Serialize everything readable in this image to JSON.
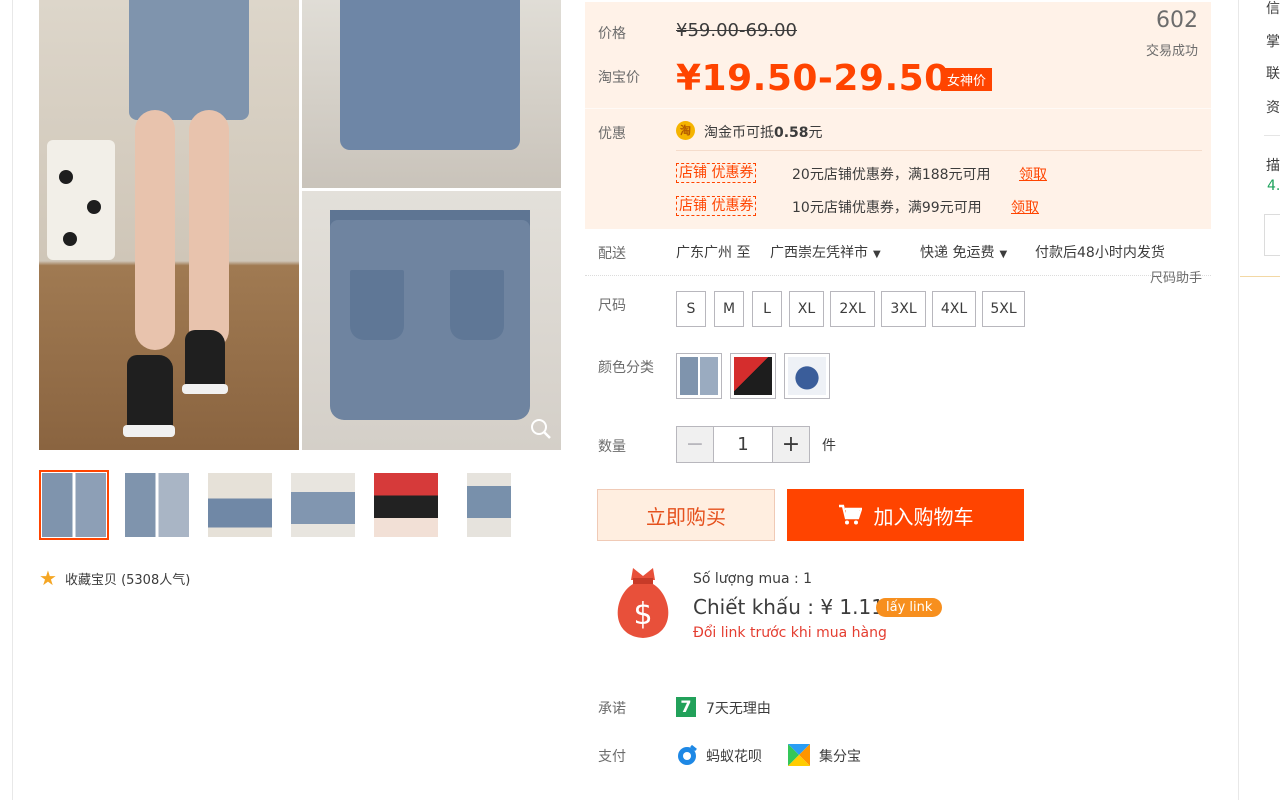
{
  "gallery": {
    "favorite_label": "收藏宝贝 (5308人气)",
    "thumbnail_count": 6
  },
  "price": {
    "label": "价格",
    "original_price": "¥59.00-69.00",
    "sold_count": "602",
    "sold_label": "交易成功",
    "promo_label": "淘宝价",
    "promo_price": "¥19.50-29.50",
    "promo_badge": "女神价"
  },
  "discounts": {
    "label": "优惠",
    "coin_glyph": "淘",
    "coin_prefix": "淘金币可抵",
    "coin_amount": "0.58",
    "coin_suffix": "元",
    "coupons": [
      {
        "tag": "店铺 优惠券",
        "text": "20元店铺优惠券，满188元可用",
        "link": "领取"
      },
      {
        "tag": "店铺 优惠券",
        "text": "10元店铺优惠券，满99元可用",
        "link": "领取"
      }
    ]
  },
  "shipping": {
    "label": "配送",
    "from": "广东广州 至",
    "to": "广西崇左凭祥市",
    "method": "快递 免运费",
    "dispatch": "付款后48小时内发货",
    "size_helper": "尺码助手"
  },
  "size": {
    "label": "尺码",
    "options": [
      "S",
      "M",
      "L",
      "XL",
      "2XL",
      "3XL",
      "4XL",
      "5XL"
    ]
  },
  "color": {
    "label": "颜色分类",
    "option_count": 3
  },
  "quantity": {
    "label": "数量",
    "minus": "−",
    "value": "1",
    "plus": "+",
    "unit": "件"
  },
  "actions": {
    "buy_now": "立即购买",
    "add_cart": "加入购物车"
  },
  "extension": {
    "buy_count": "Số lượng mua : 1",
    "discount": "Chiết khấu : ¥ 1.11",
    "get_link": "lấy link",
    "notice": "Đổi link trước khi mua hàng"
  },
  "service": {
    "promise_label": "承诺",
    "promise_icon_glyph": "7",
    "promise_text": "7天无理由",
    "pay_label": "支付",
    "pay_huabei": "蚂蚁花呗",
    "pay_jifenbao": "集分宝"
  },
  "sidebar": {
    "items": [
      "信",
      "掌",
      "联",
      "资"
    ],
    "desc": "描",
    "score": "4."
  },
  "colors": {
    "accent": "#ff4400",
    "price_bg": "#fff2e8",
    "link_orange": "#f78f1e",
    "notice_red": "#e43d30",
    "promise_green": "#22a15a"
  },
  "icons": [
    "zoom-icon",
    "star-icon",
    "coin-icon",
    "cart-icon",
    "moneybag-icon",
    "promise-icon",
    "huabei-icon",
    "jifenbao-icon",
    "caret-down-icon"
  ]
}
